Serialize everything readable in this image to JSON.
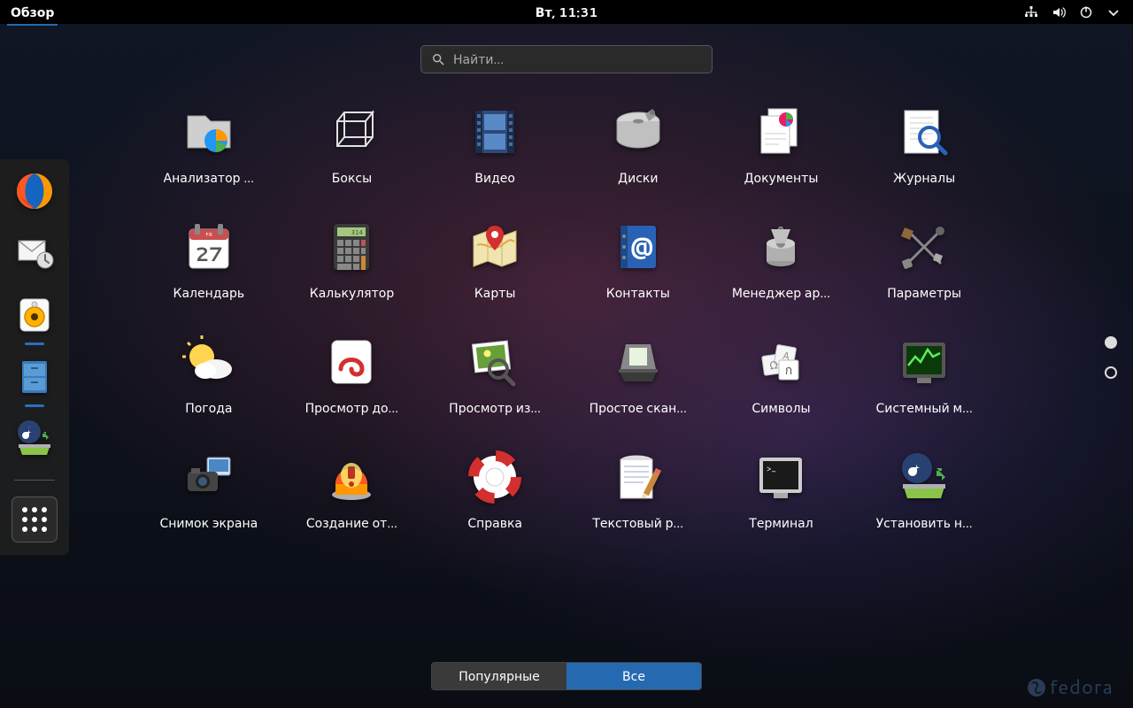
{
  "topbar": {
    "overview_label": "Обзор",
    "clock": "Вт, 11:31"
  },
  "search": {
    "placeholder": "Найти…"
  },
  "tabs": {
    "frequent": "Популярные",
    "all": "Все",
    "active": "all"
  },
  "brand": "fedora",
  "dock": [
    {
      "name": "firefox",
      "running": false
    },
    {
      "name": "evolution",
      "running": false
    },
    {
      "name": "rhythmbox",
      "running": true
    },
    {
      "name": "files",
      "running": true
    },
    {
      "name": "installer",
      "running": false
    }
  ],
  "apps": [
    {
      "name": "disk-usage",
      "label": "Анализатор …"
    },
    {
      "name": "boxes",
      "label": "Боксы"
    },
    {
      "name": "videos",
      "label": "Видео"
    },
    {
      "name": "disks",
      "label": "Диски"
    },
    {
      "name": "documents",
      "label": "Документы"
    },
    {
      "name": "logs",
      "label": "Журналы"
    },
    {
      "name": "calendar",
      "label": "Календарь"
    },
    {
      "name": "calculator",
      "label": "Калькулятор"
    },
    {
      "name": "maps",
      "label": "Карты"
    },
    {
      "name": "contacts",
      "label": "Контакты"
    },
    {
      "name": "archive",
      "label": "Менеджер ар…"
    },
    {
      "name": "settings",
      "label": "Параметры"
    },
    {
      "name": "weather",
      "label": "Погода"
    },
    {
      "name": "doc-viewer",
      "label": "Просмотр до…"
    },
    {
      "name": "image-viewer",
      "label": "Просмотр из…"
    },
    {
      "name": "scan",
      "label": "Простое скан…"
    },
    {
      "name": "characters",
      "label": "Символы"
    },
    {
      "name": "system-monitor",
      "label": "Системный м…"
    },
    {
      "name": "screenshot",
      "label": "Снимок экрана"
    },
    {
      "name": "problem-report",
      "label": "Создание от…"
    },
    {
      "name": "help",
      "label": "Справка"
    },
    {
      "name": "gedit",
      "label": "Текстовый р…"
    },
    {
      "name": "terminal",
      "label": "Терминал"
    },
    {
      "name": "install",
      "label": "Установить н…"
    }
  ],
  "calendar_day": "27",
  "calendar_weekday": "FR"
}
